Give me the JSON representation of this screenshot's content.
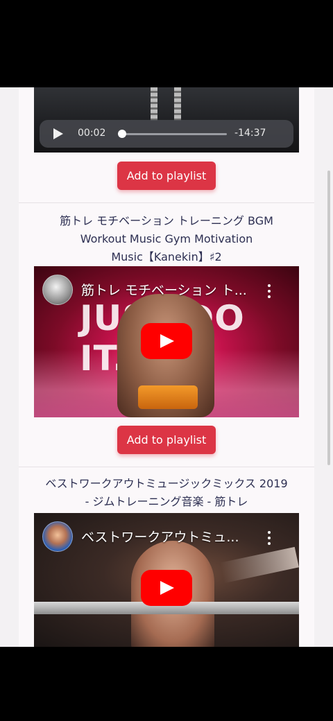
{
  "audio_player": {
    "current_time": "00:02",
    "remaining_time": "-14:37",
    "progress_fraction": 0.002
  },
  "items": [
    {
      "button_label": "Add to playlist"
    },
    {
      "title_line1": "筋トレ モチベーション トレーニング BGM",
      "title_line2": "Workout Music Gym Motivation",
      "title_line3": "Music【Kanekin】♯2",
      "video_title": "筋トレ モチベーション ト...",
      "thumbnail_text": "JUST  DO IT.",
      "button_label": "Add to playlist"
    },
    {
      "title_line1": "ベストワークアウトミュージックミックス 2019",
      "title_line2": "- ジムトレーニング音楽 - 筋トレ",
      "video_title": "ベストワークアウトミュ..."
    }
  ],
  "colors": {
    "accent": "#dc3545",
    "title_text": "#2d2f52",
    "youtube_red": "#ff0000"
  }
}
